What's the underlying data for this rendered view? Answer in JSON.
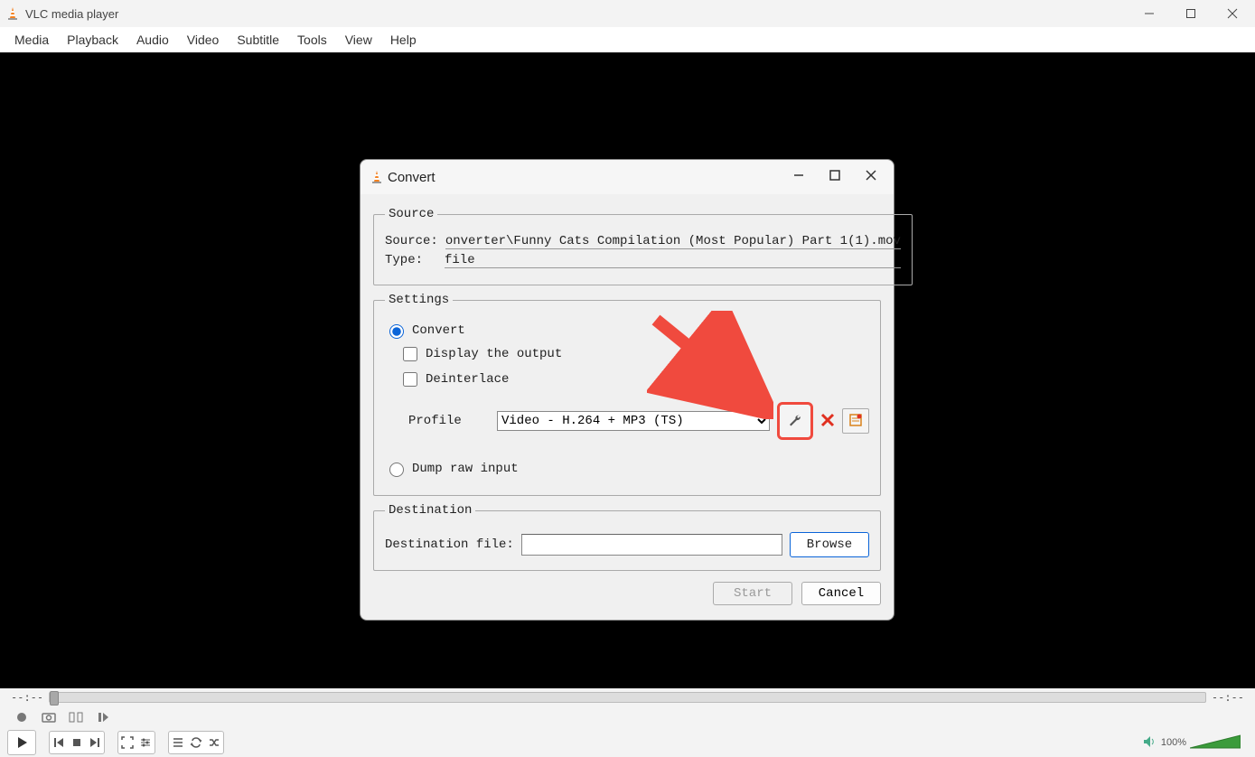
{
  "app": {
    "title": "VLC media player"
  },
  "menu": [
    "Media",
    "Playback",
    "Audio",
    "Video",
    "Subtitle",
    "Tools",
    "View",
    "Help"
  ],
  "player": {
    "time_elapsed": "--:--",
    "time_total": "--:--",
    "volume_pct": "100%"
  },
  "dialog": {
    "title": "Convert",
    "source": {
      "legend": "Source",
      "source_label": "Source:",
      "source_value": "onverter\\Funny Cats Compilation (Most Popular) Part 1(1).mov",
      "type_label": "Type:",
      "type_value": "file"
    },
    "settings": {
      "legend": "Settings",
      "convert_label": "Convert",
      "display_output_label": "Display the output",
      "deinterlace_label": "Deinterlace",
      "profile_label": "Profile",
      "profile_value": "Video - H.264 + MP3 (TS)",
      "dump_label": "Dump raw input"
    },
    "destination": {
      "legend": "Destination",
      "file_label": "Destination file:",
      "file_value": "",
      "browse_label": "Browse"
    },
    "actions": {
      "start": "Start",
      "cancel": "Cancel"
    }
  }
}
